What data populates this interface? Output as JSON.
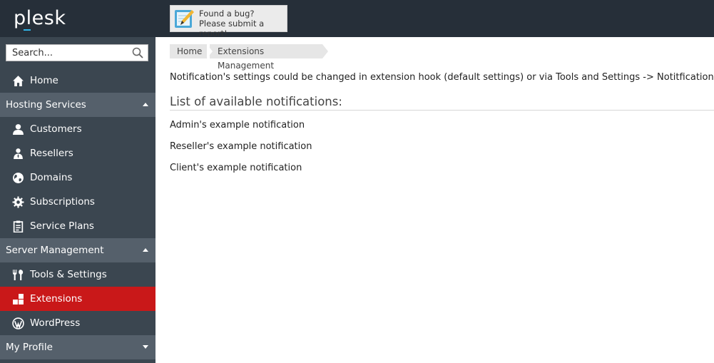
{
  "header": {
    "logo_text": "plesk",
    "bug_report": {
      "line1": "Found a bug?",
      "line2": "Please submit a report!"
    }
  },
  "sidebar": {
    "search_placeholder": "Search...",
    "home": "Home",
    "sections": [
      {
        "label": "Hosting Services",
        "expanded": true,
        "items": [
          "Customers",
          "Resellers",
          "Domains",
          "Subscriptions",
          "Service Plans"
        ]
      },
      {
        "label": "Server Management",
        "expanded": true,
        "items": [
          "Tools & Settings",
          "Extensions",
          "WordPress"
        ]
      },
      {
        "label": "My Profile",
        "expanded": false,
        "items": []
      }
    ],
    "active_item": "Extensions"
  },
  "breadcrumb": [
    "Home",
    "Extensions Management"
  ],
  "main": {
    "info_text": "Notification's settings could be changed in extension hook (default settings) or via Tools and Settings -> Notitfications.",
    "list_title": "List of available notifications:",
    "notifications": [
      "Admin's example notification",
      "Reseller's example notification",
      "Client's example notification"
    ]
  },
  "colors": {
    "topbar": "#262f39",
    "sidebar": "#3b4650",
    "section_header": "#55606b",
    "active": "#c91819",
    "logo_accent": "#31b4e8"
  }
}
